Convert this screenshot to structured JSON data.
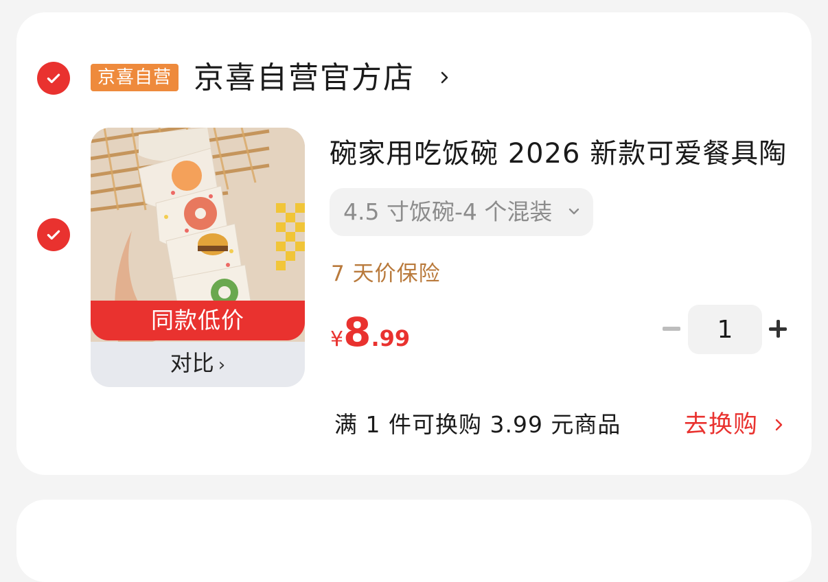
{
  "colors": {
    "accent": "#e9322f",
    "badge": "#ee8a3c",
    "insurance": "#b97a3c"
  },
  "store": {
    "checked": true,
    "badge": "京喜自营",
    "name": "京喜自营官方店"
  },
  "item": {
    "checked": true,
    "title": "碗家用吃饭碗 2026 新款可爱餐具陶",
    "spec": "4.5 寸饭碗-4 个混装",
    "insurance": "7 天价保险",
    "price": {
      "symbol": "¥",
      "integer": "8",
      "decimal": ".99"
    },
    "quantity": "1",
    "image_tag": "同款低价",
    "compare_label": "对比",
    "compare_chevron": "›"
  },
  "promo": {
    "text": "满 1 件可换购 3.99 元商品",
    "action": "去换购"
  },
  "icons": {
    "check": "check-icon",
    "store_chevron": "chevron-right-icon",
    "spec_dropdown": "chevron-down-icon",
    "minus": "minus-icon",
    "plus": "plus-icon"
  }
}
